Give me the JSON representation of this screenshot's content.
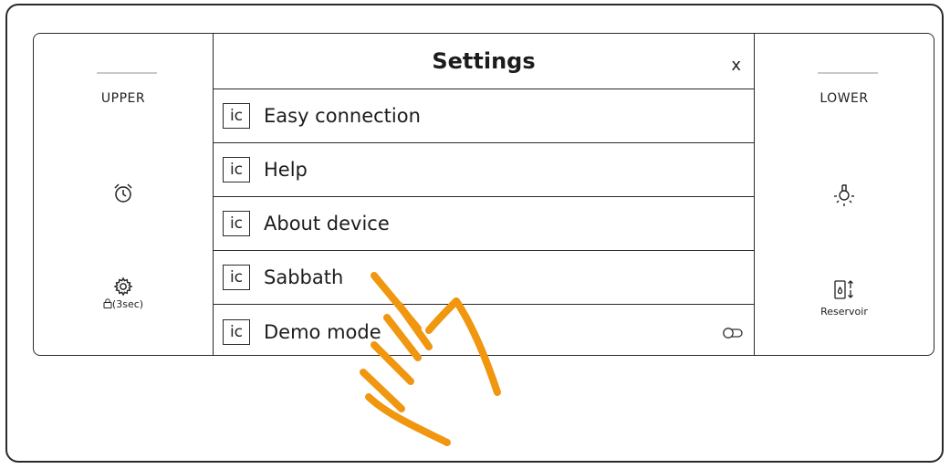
{
  "left_panel": {
    "label": "UPPER",
    "timer_icon": "alarm-clock-icon",
    "settings_icon": "gear-icon",
    "lock_caption": "⌂(3sec)"
  },
  "right_panel": {
    "label": "LOWER",
    "light_icon": "light-bulb-icon",
    "reservoir_icon": "reservoir-icon",
    "reservoir_caption": "Reservoir"
  },
  "menu": {
    "title": "Settings",
    "close_label": "x",
    "items": [
      {
        "icon_label": "ic",
        "label": "Easy connection"
      },
      {
        "icon_label": "ic",
        "label": "Help"
      },
      {
        "icon_label": "ic",
        "label": "About device"
      },
      {
        "icon_label": "ic",
        "label": "Sabbath"
      },
      {
        "icon_label": "ic",
        "label": "Demo mode",
        "toggle": "off"
      }
    ]
  },
  "overlay": {
    "gesture_icon": "tap-hand-icon",
    "accent_color": "#f0960f"
  }
}
